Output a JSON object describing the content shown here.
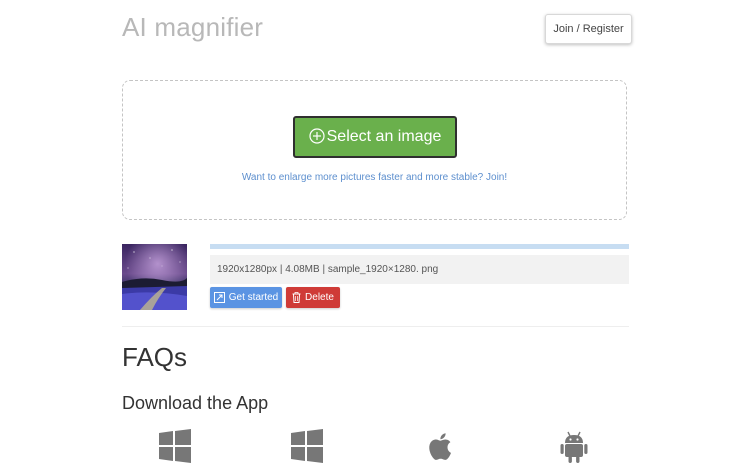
{
  "header": {
    "app_title": "AI magnifier",
    "join_label": "Join / Register"
  },
  "upload": {
    "select_label": "Select an image",
    "join_hint": "Want to enlarge more pictures faster and more stable? Join!"
  },
  "file": {
    "info": "1920x1280px | 4.08MB | sample_1920×1280. png",
    "progress_percent": 100,
    "get_started_label": "Get started",
    "delete_label": "Delete"
  },
  "faq": {
    "heading": "FAQs"
  },
  "download": {
    "heading": "Download the App",
    "apps": [
      {
        "icon": "windows-icon"
      },
      {
        "icon": "windows-icon"
      },
      {
        "icon": "apple-icon"
      },
      {
        "icon": "android-icon"
      }
    ]
  },
  "colors": {
    "title": "#b8b8b8",
    "select_button": "#6ab04c",
    "link": "#5d8fce",
    "get_started": "#5b94e3",
    "delete": "#cf3b37",
    "icon_gray": "#777777"
  }
}
